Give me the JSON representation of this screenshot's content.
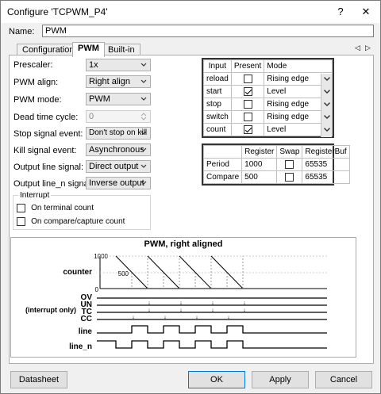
{
  "window": {
    "title": "Configure 'TCPWM_P4'",
    "help": "?",
    "close": "✕"
  },
  "name": {
    "label": "Name:",
    "value": "PWM"
  },
  "tabs": [
    {
      "label": "Configuration"
    },
    {
      "label": "PWM"
    },
    {
      "label": "Built-in"
    }
  ],
  "tab_scroll": {
    "left": "◁",
    "right": "▷"
  },
  "form": {
    "prescaler": {
      "label": "Prescaler:",
      "value": "1x"
    },
    "pwm_align": {
      "label": "PWM align:",
      "value": "Right align"
    },
    "pwm_mode": {
      "label": "PWM mode:",
      "value": "PWM"
    },
    "dead_time": {
      "label": "Dead time cycle:",
      "value": "0"
    },
    "stop_signal": {
      "label": "Stop signal event:",
      "value": "Don't stop on kill"
    },
    "kill_signal": {
      "label": "Kill signal event:",
      "value": "Asynchronous"
    },
    "output_line": {
      "label": "Output line signal:",
      "value": "Direct output"
    },
    "output_line_n": {
      "label": "Output line_n signal:",
      "value": "Inverse output"
    }
  },
  "interrupt": {
    "title": "Interrupt",
    "terminal": {
      "label": "On terminal count",
      "checked": false
    },
    "compare": {
      "label": "On compare/capture count",
      "checked": false
    }
  },
  "input_table": {
    "headers": [
      "Input",
      "Present",
      "Mode"
    ],
    "rows": [
      {
        "input": "reload",
        "present": false,
        "mode": "Rising edge"
      },
      {
        "input": "start",
        "present": true,
        "mode": "Level"
      },
      {
        "input": "stop",
        "present": false,
        "mode": "Rising edge"
      },
      {
        "input": "switch",
        "present": false,
        "mode": "Rising edge"
      },
      {
        "input": "count",
        "present": true,
        "mode": "Level"
      }
    ]
  },
  "register_table": {
    "headers": [
      "",
      "Register",
      "Swap",
      "RegisterBuf"
    ],
    "rows": [
      {
        "name": "Period",
        "register": "1000",
        "swap": false,
        "buf": "65535"
      },
      {
        "name": "Compare",
        "register": "500",
        "swap": false,
        "buf": "65535"
      }
    ]
  },
  "diagram": {
    "title": "PWM, right aligned",
    "counter_label": "counter",
    "y_ticks": [
      "1000",
      "500",
      "0"
    ],
    "events": [
      "OV",
      "UN",
      "TC",
      "CC"
    ],
    "interrupt_note": "(interrupt only)",
    "line_label": "line",
    "line_n_label": "line_n"
  },
  "buttons": {
    "datasheet": "Datasheet",
    "ok": "OK",
    "apply": "Apply",
    "cancel": "Cancel"
  }
}
